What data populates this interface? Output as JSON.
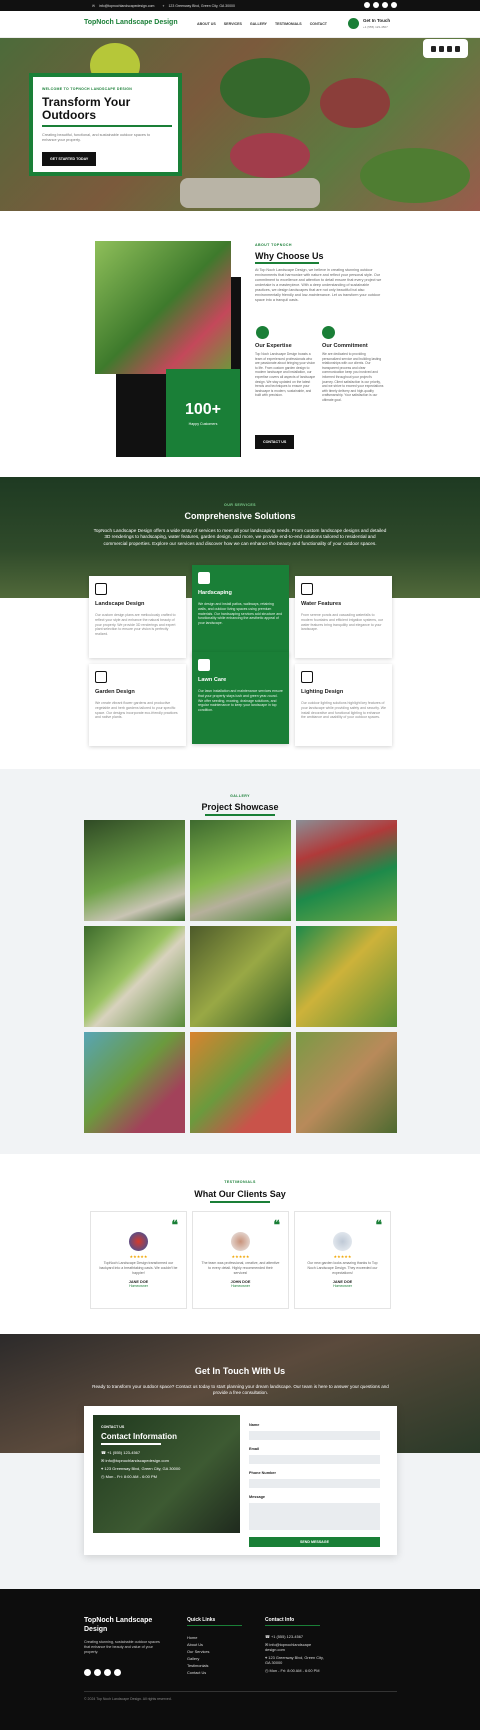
{
  "topbar": {
    "email": "info@topnochlandscapedesign.com",
    "address": "123 Greenway Blvd, Green City, GA 30000"
  },
  "header": {
    "logo": "TopNoch Landscape Design",
    "nav": [
      "ABOUT US",
      "SERVICES",
      "GALLERY",
      "TESTIMONIALS",
      "CONTACT"
    ],
    "touch_title": "Get In Touch",
    "touch_phone": "+1 (555) 123-4567"
  },
  "hero": {
    "kicker": "WELCOME TO TOPNOCH LANDSCAPE DESIGN",
    "title": "Transform Your Outdoors",
    "text": "Creating beautiful, functional, and sustainable outdoor spaces to enhance your property.",
    "button": "GET STARTED TODAY"
  },
  "about": {
    "kicker": "ABOUT TOPNOCH",
    "title": "Why Choose Us",
    "text": "At Top Noch Landscape Design, we believe in creating stunning outdoor environments that harmonize with nature and reflect your personal style. Our commitment to excellence and attention to detail ensure that every project we undertake is a masterpiece. With a deep understanding of sustainable practices, we design landscapes that are not only beautiful but also environmentally friendly and low-maintenance. Let us transform your outdoor space into a tranquil oasis.",
    "stat_number": "100+",
    "stat_label": "Happy Customers",
    "expertise_title": "Our Expertise",
    "expertise_text": "Top Noch Landscape Design boasts a team of experienced professionals who are passionate about bringing your vision to life. From custom garden design to modern landscape and installation, our expertise covers all aspects of landscape design. We stay updated on the latest trends and techniques to ensure your landscape is modern, sustainable, and built with precision.",
    "commitment_title": "Our Commitment",
    "commitment_text": "We are dedicated to providing personalized service and building lasting relationships with our clients. Our transparent process and clear communication keep you involved and informed throughout your project's journey. Client satisfaction is our priority, and we strive to exceed your expectations with timely delivery and high-quality craftsmanship. Your satisfaction is our ultimate goal.",
    "button": "CONTACT US"
  },
  "services": {
    "kicker": "OUR SERVICES",
    "title": "Comprehensive Solutions",
    "intro": "TopNoch Landscape Design offers a wide array of services to meet all your landscaping needs. From custom landscape designs and detailed 3D renderings to hardscaping, water features, garden design, and more, we provide end-to-end solutions tailored to residential and commercial properties. Explore our services and discover how we can enhance the beauty and functionality of your outdoor spaces.",
    "cards": [
      {
        "title": "Landscape Design",
        "text": "Our custom design plans are meticulously crafted to reflect your style and enhance the natural beauty of your property. We provide 3D renderings and expert plant selection to ensure your vision is perfectly realized."
      },
      {
        "title": "Hardscaping",
        "text": "We design and install patios, walkways, retaining walls, and outdoor living spaces using premium materials. Our hardscaping services add structure and functionality while enhancing the aesthetic appeal of your landscape."
      },
      {
        "title": "Water Features",
        "text": "From serene ponds and cascading waterfalls to modern fountains and efficient irrigation systems, our water features bring tranquility and elegance to your landscape."
      },
      {
        "title": "Garden Design",
        "text": "We create vibrant flower gardens and productive vegetable and herb gardens tailored to your specific space. Our designs incorporate eco-friendly practices and native plants."
      },
      {
        "title": "Lawn Care",
        "text": "Our lawn installation and maintenance services ensure that your property stays lush and green year-round. We offer seeding, mowing, drainage solutions, and regular maintenance to keep your landscape in top condition."
      },
      {
        "title": "Lighting Design",
        "text": "Our outdoor lighting solutions highlight key features of your landscape while providing safety and security. We install decorative and functional lighting to enhance the ambiance and usability of your outdoor spaces."
      }
    ]
  },
  "gallery": {
    "kicker": "GALLERY",
    "title": "Project Showcase"
  },
  "testimonials": {
    "kicker": "TESTIMONIALS",
    "title": "What Our Clients Say",
    "items": [
      {
        "text": "TopNoch Landscape Design transformed our backyard into a breathtaking oasis. We couldn't be happier!",
        "name": "JANE DOE",
        "role": "Homeowner",
        "stars": "★★★★★"
      },
      {
        "text": "The team was professional, creative, and attentive to every detail. Highly recommended their services!",
        "name": "JOHN DOE",
        "role": "Homeowner",
        "stars": "★★★★★"
      },
      {
        "text": "Our new garden looks amazing thanks to Top Noch Landscape Design. They exceeded our expectations!",
        "name": "JANE DOE",
        "role": "Homeowner",
        "stars": "★★★★★"
      }
    ]
  },
  "contact": {
    "title": "Get In Touch With Us",
    "intro": "Ready to transform your outdoor space? Contact us today to start planning your dream landscape. Our team is here to answer your questions and provide a free consultation.",
    "info_kicker": "CONTACT US",
    "info_title": "Contact Information",
    "phone": "+1 (555) 123-4567",
    "email": "info@topnochlandscapedesign.com",
    "address": "123 Greenway Blvd, Green City, GA 30000",
    "hours": "Mon - Fri: 8:00 AM - 6:00 PM",
    "form": {
      "name": "Name",
      "email": "Email",
      "phone": "Phone Number",
      "message": "Message",
      "submit": "SEND MESSAGE"
    }
  },
  "footer": {
    "title": "TopNoch Landscape Design",
    "text": "Creating stunning, sustainable outdoor spaces that enhance the beauty and value of your property.",
    "links_title": "Quick Links",
    "links": [
      "Home",
      "About Us",
      "Our Services",
      "Gallery",
      "Testimonials",
      "Contact Us"
    ],
    "info_title": "Contact Info",
    "phone": "+1 (555) 123-4567",
    "email": "info@topnochlandscape design.com",
    "address": "123 Greenway Blvd, Green City, GA 30000",
    "hours": "Mon - Fri: 8:00 AM - 6:00 PM",
    "copyright": "© 2024 Top Noch Landscape Design. All rights reserved."
  },
  "colors": {
    "brand": "#1a7f37",
    "dark": "#111111"
  }
}
